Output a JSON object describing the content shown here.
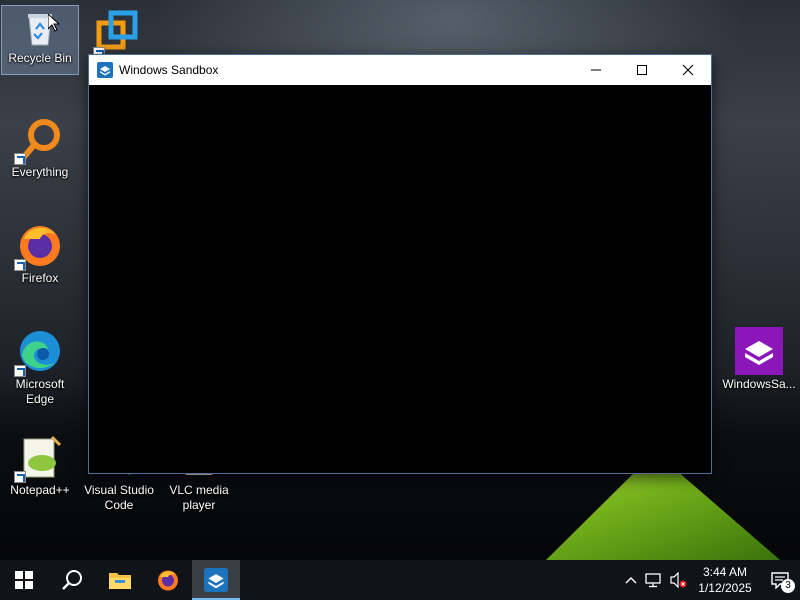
{
  "desktop": {
    "icons": [
      {
        "label": "Recycle Bin",
        "icon": "recycle-bin-icon"
      },
      {
        "label": "",
        "icon": "vmware-icon"
      },
      {
        "label": "Everything",
        "icon": "everything-icon"
      },
      {
        "label": "Firefox",
        "icon": "firefox-icon"
      },
      {
        "label": "Microsoft Edge",
        "icon": "edge-icon"
      },
      {
        "label": "Notepad++",
        "icon": "notepadpp-icon"
      },
      {
        "label": "Visual Studio Code",
        "icon": "vscode-icon"
      },
      {
        "label": "VLC media player",
        "icon": "vlc-icon"
      },
      {
        "label": "WindowsSa...",
        "icon": "windows-sandbox-icon"
      }
    ]
  },
  "window": {
    "title": "Windows Sandbox",
    "icon": "windows-sandbox-icon",
    "accent": "#1e73be"
  },
  "taskbar": {
    "items": [
      {
        "name": "start",
        "icon": "windows-logo-icon"
      },
      {
        "name": "search",
        "icon": "search-icon"
      },
      {
        "name": "file-explorer",
        "icon": "folder-icon"
      },
      {
        "name": "firefox",
        "icon": "firefox-icon"
      },
      {
        "name": "windows-sandbox",
        "icon": "windows-sandbox-icon",
        "active": true
      }
    ],
    "tray": {
      "time": "3:44 AM",
      "date": "1/12/2025",
      "notification_count": "3"
    }
  },
  "colors": {
    "taskbar": "#101418",
    "active_indicator": "#76b9ed",
    "sandbox_purple": "#8b17b8"
  }
}
